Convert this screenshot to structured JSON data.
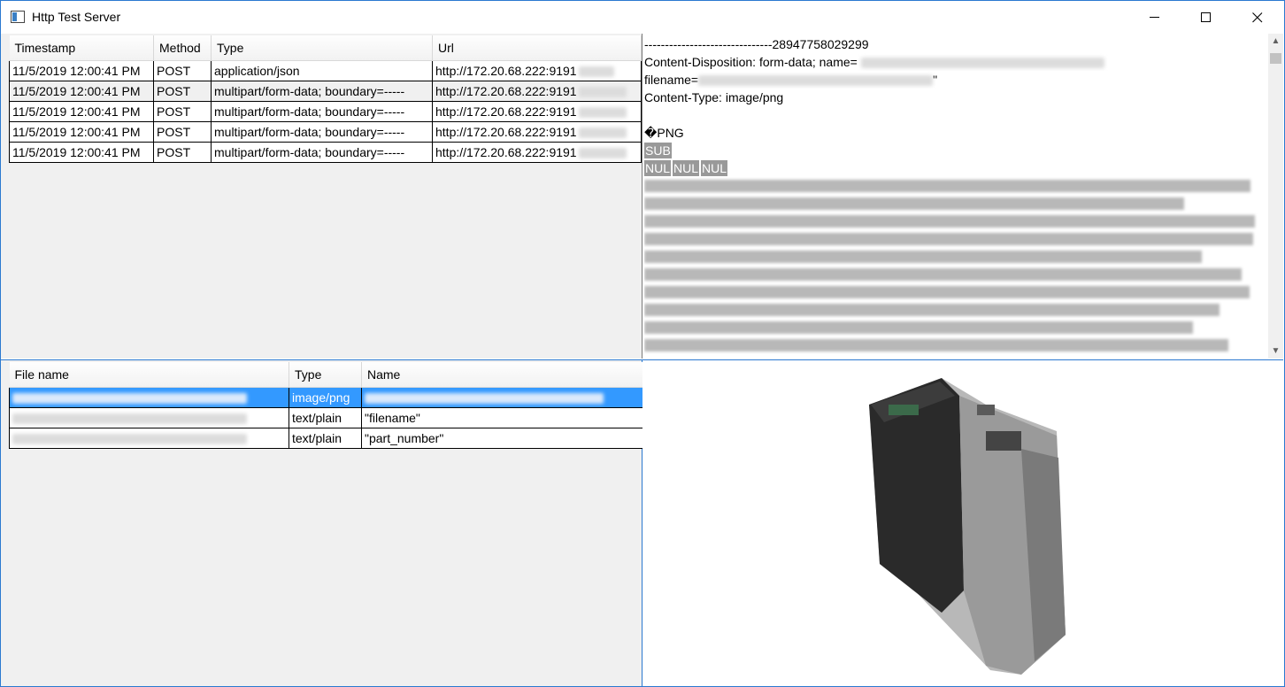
{
  "window": {
    "title": "Http Test Server"
  },
  "requests": {
    "columns": [
      "Timestamp",
      "Method",
      "Type",
      "Url"
    ],
    "rows": [
      {
        "timestamp": "11/5/2019 12:00:41 PM",
        "method": "POST",
        "type": "application/json",
        "url": "http://172.20.68.222:9191"
      },
      {
        "timestamp": "11/5/2019 12:00:41 PM",
        "method": "POST",
        "type": "multipart/form-data; boundary=-----",
        "url": "http://172.20.68.222:9191"
      },
      {
        "timestamp": "11/5/2019 12:00:41 PM",
        "method": "POST",
        "type": "multipart/form-data; boundary=-----",
        "url": "http://172.20.68.222:9191"
      },
      {
        "timestamp": "11/5/2019 12:00:41 PM",
        "method": "POST",
        "type": "multipart/form-data; boundary=-----",
        "url": "http://172.20.68.222:9191"
      },
      {
        "timestamp": "11/5/2019 12:00:41 PM",
        "method": "POST",
        "type": "multipart/form-data; boundary=-----",
        "url": "http://172.20.68.222:9191"
      }
    ]
  },
  "raw_body": {
    "boundary": "-------------------------------28947758029299",
    "disposition": "Content-Disposition: form-data; name=",
    "filename_prefix": "filename=",
    "filename_suffix": "\"",
    "content_type": "Content-Type: image/png",
    "png_sig": "�PNG",
    "sub": "SUB",
    "nul1": "NUL",
    "nul2": "NUL",
    "nul3": "NUL"
  },
  "parts": {
    "columns": [
      "File name",
      "Type",
      "Name"
    ],
    "rows": [
      {
        "type": "image/png",
        "name": ""
      },
      {
        "type": "text/plain",
        "name": "\"filename\""
      },
      {
        "type": "text/plain",
        "name": "\"part_number\""
      }
    ]
  },
  "colors": {
    "accent": "#2b79d0",
    "selection": "#3399ff"
  }
}
